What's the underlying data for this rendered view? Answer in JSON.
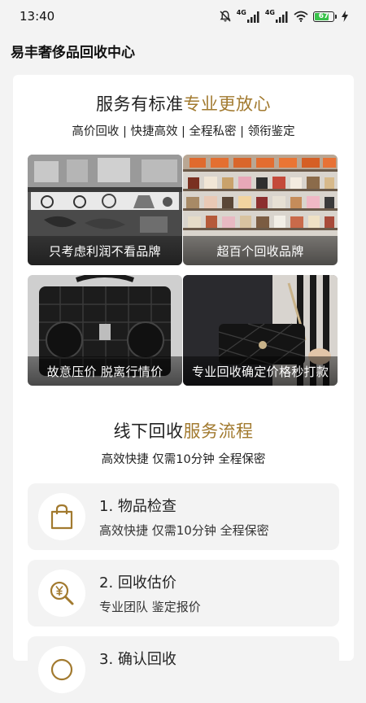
{
  "status_bar": {
    "time": "13:40",
    "network_label": "4G",
    "network_label_2": "4G",
    "battery_level": "67",
    "icons": [
      "mute-icon",
      "signal-4g-icon",
      "signal-4g-icon",
      "wifi-icon",
      "battery-icon",
      "charging-icon"
    ]
  },
  "header": {
    "title": "易丰奢侈品回收中心"
  },
  "service": {
    "title_main": "服务有标准",
    "title_accent": "专业更放心",
    "subtitle": "高价回收 | 快捷高效 | 全程私密 | 领衔鉴定",
    "tiles": [
      {
        "caption": "只考虑利润不看品牌"
      },
      {
        "caption": "超百个回收品牌"
      },
      {
        "caption": "故意压价 脱离行情价"
      },
      {
        "caption": "专业回收确定价格秒打款"
      }
    ]
  },
  "process": {
    "title_main": "线下回收",
    "title_accent": "服务流程",
    "subtitle": "高效快捷 仅需10分钟 全程保密",
    "steps": [
      {
        "title": "1. 物品检查",
        "desc": "高效快捷 仅需10分钟 全程保密",
        "icon": "shopping-bag-icon"
      },
      {
        "title": "2. 回收估价",
        "desc": "专业团队 鉴定报价",
        "icon": "yen-magnifier-icon"
      },
      {
        "title": "3. 确认回收",
        "desc": "",
        "icon": "step-icon"
      }
    ]
  },
  "colors": {
    "accent": "#a27a2f",
    "card_bg": "#ffffff",
    "page_bg": "#f3f3f3",
    "battery": "#39c24a"
  }
}
